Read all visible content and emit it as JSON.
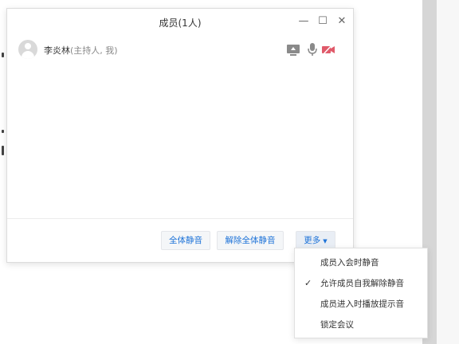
{
  "window": {
    "title": "成员(1人)",
    "controls": {
      "minimize": "—",
      "maximize": "☐",
      "close": "✕"
    }
  },
  "members": [
    {
      "name": "李炎林",
      "role": "(主持人, 我)"
    }
  ],
  "footer": {
    "mute_all": "全体静音",
    "unmute_all": "解除全体静音",
    "more": "更多"
  },
  "more_menu": {
    "items": [
      {
        "label": "成员入会时静音",
        "checked": false
      },
      {
        "label": "允许成员自我解除静音",
        "checked": true
      },
      {
        "label": "成员进入时播放提示音",
        "checked": false
      },
      {
        "label": "锁定会议",
        "checked": false
      }
    ],
    "check_mark": "✓"
  },
  "colors": {
    "accent": "#1e73d8",
    "cam_off": "#e05a6a",
    "icon_gray": "#8a8a8a"
  }
}
